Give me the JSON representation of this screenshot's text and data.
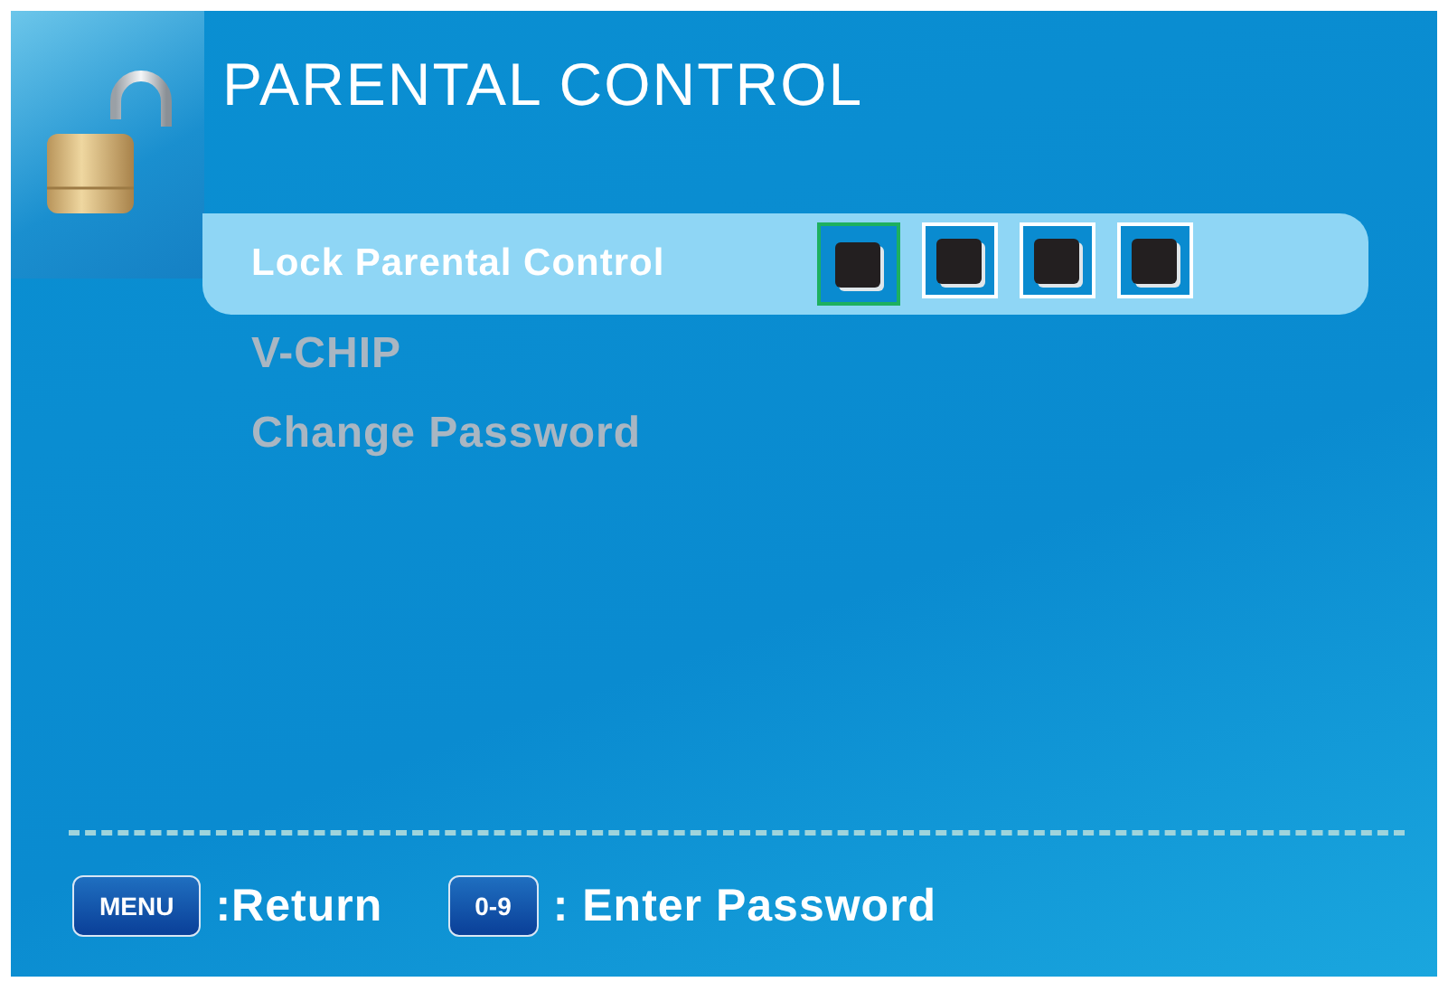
{
  "window": {
    "title": "PARENTAL CONTROL"
  },
  "menu_items": [
    {
      "label": "Lock Parental Control",
      "selected": true,
      "disabled": false,
      "kind": "pin",
      "pin_digits": [
        {
          "selected": true
        },
        {
          "selected": false
        },
        {
          "selected": false
        },
        {
          "selected": false
        }
      ]
    },
    {
      "label": "V-CHIP",
      "selected": false,
      "disabled": true,
      "kind": "plain"
    },
    {
      "label": "Change Password",
      "selected": false,
      "disabled": true,
      "kind": "plain"
    }
  ],
  "footer": [
    {
      "key": "MENU",
      "action": ":Return"
    },
    {
      "key": "0-9",
      "action": ": Enter Password"
    }
  ]
}
